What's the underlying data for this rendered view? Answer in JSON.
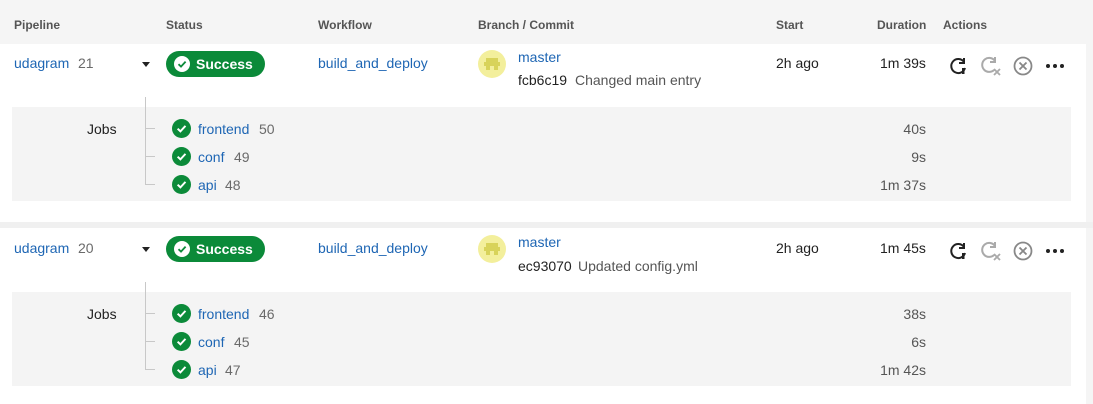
{
  "header": {
    "pipeline": "Pipeline",
    "status": "Status",
    "workflow": "Workflow",
    "branch_commit": "Branch / Commit",
    "start": "Start",
    "duration": "Duration",
    "actions": "Actions"
  },
  "pipelines": [
    {
      "name": "udagram",
      "number": "21",
      "status": "Success",
      "workflow": "build_and_deploy",
      "branch": "master",
      "commit_hash": "fcb6c19",
      "commit_message": "Changed main entry",
      "start": "2h ago",
      "duration": "1m 39s",
      "jobs_label": "Jobs",
      "jobs": [
        {
          "name": "frontend",
          "number": "50",
          "duration": "40s"
        },
        {
          "name": "conf",
          "number": "49",
          "duration": "9s"
        },
        {
          "name": "api",
          "number": "48",
          "duration": "1m 37s"
        }
      ]
    },
    {
      "name": "udagram",
      "number": "20",
      "status": "Success",
      "workflow": "build_and_deploy",
      "branch": "master",
      "commit_hash": "ec93070",
      "commit_message": "Updated config.yml",
      "start": "2h ago",
      "duration": "1m 45s",
      "jobs_label": "Jobs",
      "jobs": [
        {
          "name": "frontend",
          "number": "46",
          "duration": "38s"
        },
        {
          "name": "conf",
          "number": "45",
          "duration": "6s"
        },
        {
          "name": "api",
          "number": "47",
          "duration": "1m 42s"
        }
      ]
    }
  ],
  "icons": {
    "status_check": "check-icon",
    "rerun": "rerun-icon",
    "rerun_failed": "rerun-failed-icon",
    "cancel": "cancel-icon",
    "more": "more-icon",
    "avatar": "user-avatar-icon"
  },
  "colors": {
    "success": "#0b8a39",
    "link": "#1e66b4",
    "avatar_bg": "#f3ef9c"
  }
}
